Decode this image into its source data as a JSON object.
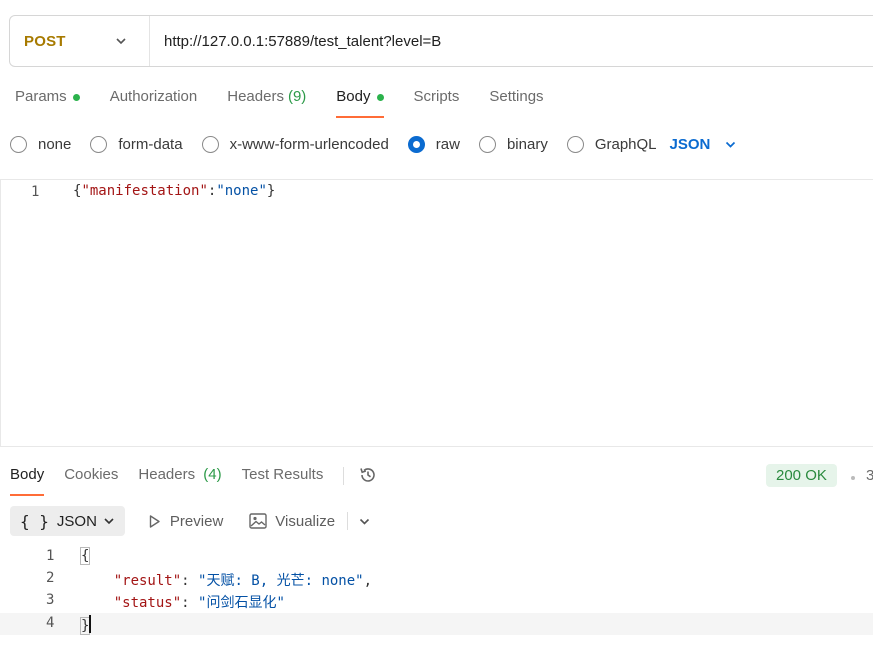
{
  "request": {
    "method": "POST",
    "url": "http://127.0.0.1:57889/test_talent?level=B"
  },
  "request_tabs": [
    {
      "label": "Params",
      "dot": true
    },
    {
      "label": "Authorization"
    },
    {
      "label": "Headers",
      "count": "(9)"
    },
    {
      "label": "Body",
      "dot": true,
      "active": true
    },
    {
      "label": "Scripts"
    },
    {
      "label": "Settings"
    }
  ],
  "body_types": {
    "options": [
      "none",
      "form-data",
      "x-www-form-urlencoded",
      "raw",
      "binary",
      "GraphQL"
    ],
    "selected": "raw",
    "format": "JSON"
  },
  "request_body": {
    "line_number": "1",
    "brace_open": "{",
    "key": "\"manifestation\"",
    "colon": ":",
    "value": "\"none\"",
    "brace_close": "}"
  },
  "response_tabs": [
    {
      "label": "Body",
      "active": true
    },
    {
      "label": "Cookies"
    },
    {
      "label": "Headers",
      "count": "(4)"
    },
    {
      "label": "Test Results"
    }
  ],
  "response_status": "200 OK",
  "response_time_fragment": "3",
  "response_tools": {
    "format": "JSON",
    "preview": "Preview",
    "visualize": "Visualize"
  },
  "response_body": {
    "line_numbers": [
      "1",
      "2",
      "3",
      "4"
    ],
    "open": "{",
    "result_key": "\"result\"",
    "result_value": "\"天赋: B, 光芒: none\"",
    "status_key": "\"status\"",
    "status_value": "\"问剑石显化\"",
    "close": "}"
  },
  "colors": {
    "method": "#a77a00",
    "active_tab_underline": "#ff6c37",
    "radio_checked": "#0b6bd0",
    "status_badge_bg": "#e6f4ea",
    "json_key": "#a31515",
    "json_string": "#0451a5"
  }
}
